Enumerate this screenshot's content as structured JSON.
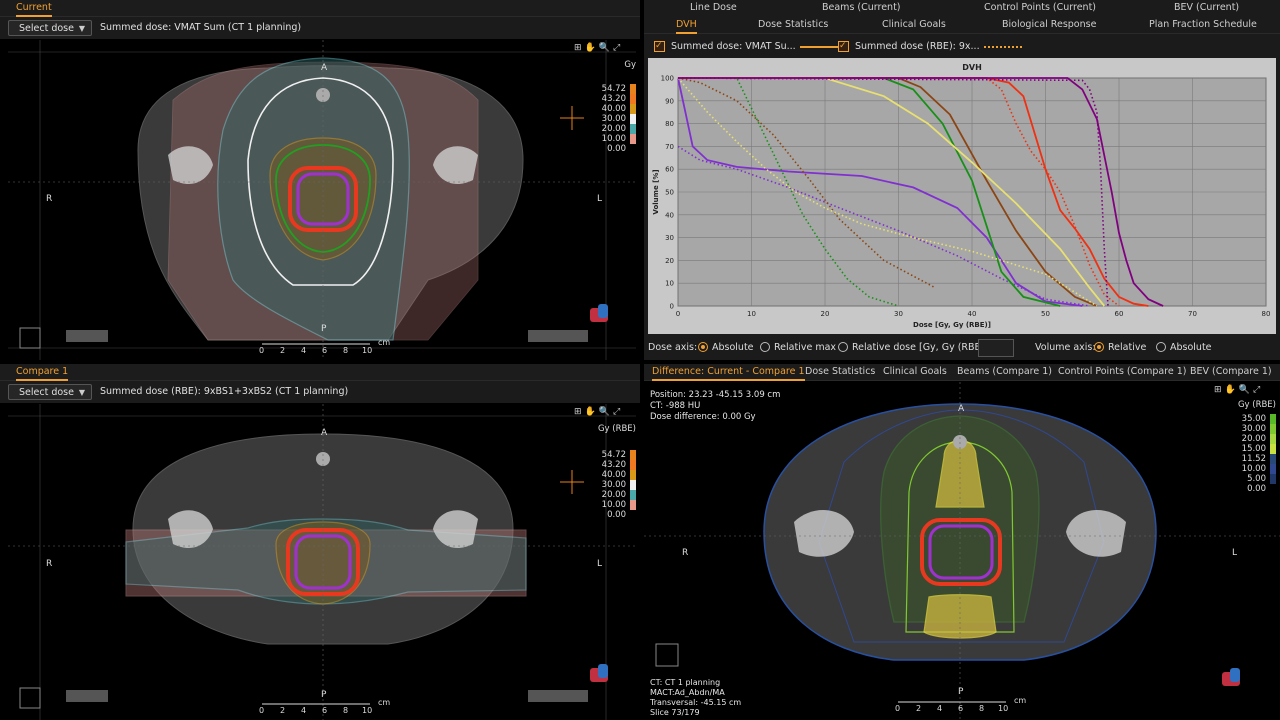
{
  "colors": {
    "accent": "#f0a030",
    "bg": "#000000",
    "tabbar": "#1c1c1c",
    "chart_bg": "#a7a7a7"
  },
  "top_left": {
    "tab": "Current",
    "select_dose": "Select dose",
    "summed": "Summed dose: VMAT Sum (CT 1 planning)",
    "orient": {
      "a": "A",
      "p": "P",
      "r": "R",
      "l": "L"
    },
    "legend_unit": "Gy",
    "legend": [
      {
        "label": "54.72",
        "color": "#e8821c"
      },
      {
        "label": "43.20",
        "color": "#f07820"
      },
      {
        "label": "40.00",
        "color": "#d89818"
      },
      {
        "label": "30.00",
        "color": "#f0f0f0"
      },
      {
        "label": "20.00",
        "color": "#4aa8a8"
      },
      {
        "label": "10.00",
        "color": "#e89888"
      },
      {
        "label": "0.00",
        "color": ""
      }
    ],
    "scale_ticks": [
      "0",
      "2",
      "4",
      "6",
      "8",
      "10"
    ],
    "scale_unit": "cm"
  },
  "bottom_left": {
    "tab": "Compare 1",
    "select_dose": "Select dose",
    "summed": "Summed dose (RBE): 9xBS1+3xBS2 (CT 1 planning)",
    "orient": {
      "a": "A",
      "p": "P",
      "r": "R",
      "l": "L"
    },
    "legend_unit": "Gy (RBE)",
    "legend": [
      {
        "label": "54.72",
        "color": "#e8821c"
      },
      {
        "label": "43.20",
        "color": "#f07820"
      },
      {
        "label": "40.00",
        "color": "#d89818"
      },
      {
        "label": "30.00",
        "color": "#f0f0f0"
      },
      {
        "label": "20.00",
        "color": "#4aa8a8"
      },
      {
        "label": "10.00",
        "color": "#e89888"
      },
      {
        "label": "0.00",
        "color": ""
      }
    ],
    "scale_ticks": [
      "0",
      "2",
      "4",
      "6",
      "8",
      "10"
    ],
    "scale_unit": "cm"
  },
  "top_right": {
    "tabs_row1": [
      "Line Dose",
      "Beams (Current)",
      "Control Points (Current)",
      "BEV (Current)"
    ],
    "tabs_row2": [
      "DVH",
      "Dose Statistics",
      "Clinical Goals",
      "Biological Response",
      "Plan Fraction Schedule"
    ],
    "active_tab": "DVH",
    "series_toggles": [
      {
        "label": "Summed dose: VMAT Su...",
        "style": "solid"
      },
      {
        "label": "Summed dose (RBE): 9x...",
        "style": "dotted"
      }
    ],
    "dose_axis_label": "Dose axis:",
    "dose_axis_options": [
      {
        "label": "Absolute",
        "selected": true
      },
      {
        "label": "Relative max",
        "selected": false
      },
      {
        "label": "Relative dose [Gy, Gy (RBE)]:",
        "selected": false
      }
    ],
    "volume_axis_label": "Volume axis:",
    "volume_axis_options": [
      {
        "label": "Relative",
        "selected": true
      },
      {
        "label": "Absolute",
        "selected": false
      }
    ]
  },
  "bottom_right": {
    "tabs": [
      "Difference: Current - Compare 1",
      "Dose Statistics",
      "Clinical Goals",
      "Beams (Compare 1)",
      "Control Points (Compare 1)",
      "BEV (Compare 1)"
    ],
    "active_tab": "Difference: Current - Compare 1",
    "position": "Position: 23.23 -45.15 3.09 cm",
    "ct": "CT: -988 HU",
    "dose_difference": "Dose difference: 0.00 Gy",
    "orient": {
      "a": "A",
      "p": "P",
      "r": "R",
      "l": "L"
    },
    "legend_unit": "Gy (RBE)",
    "legend": [
      {
        "label": "35.00",
        "color": "#58b828"
      },
      {
        "label": "30.00",
        "color": "#80c830"
      },
      {
        "label": "20.00",
        "color": "#a8d840"
      },
      {
        "label": "15.00",
        "color": "#c8e040"
      },
      {
        "label": "11.52",
        "color": "#284878"
      },
      {
        "label": "10.00",
        "color": "#304890"
      },
      {
        "label": "5.00",
        "color": "#203868"
      },
      {
        "label": "0.00",
        "color": ""
      }
    ],
    "footer": [
      "CT: CT 1 planning",
      "MACT:Ad_Abdn/MA",
      "Transversal: -45.15 cm",
      "Slice 73/179"
    ],
    "scale_ticks": [
      "0",
      "2",
      "4",
      "6",
      "8",
      "10"
    ],
    "scale_unit": "cm"
  },
  "chart_data": {
    "type": "line",
    "title": "DVH",
    "xlabel": "Dose [Gy, Gy (RBE)]",
    "ylabel": "Volume [%]",
    "xlim": [
      0,
      80
    ],
    "ylim": [
      0,
      100
    ],
    "xticks": [
      0,
      10,
      20,
      30,
      40,
      50,
      60,
      70,
      80
    ],
    "yticks": [
      0,
      10,
      20,
      30,
      40,
      50,
      60,
      70,
      80,
      90,
      100
    ],
    "grid": true,
    "series": [
      {
        "color": "#8030d0",
        "style": "solid",
        "x": [
          0,
          1,
          2,
          4,
          8,
          15,
          25,
          32,
          38,
          42,
          46,
          50,
          55
        ],
        "y": [
          100,
          85,
          70,
          64,
          61,
          59,
          57,
          52,
          43,
          30,
          10,
          2,
          0
        ]
      },
      {
        "color": "#8030d0",
        "style": "dotted",
        "x": [
          0,
          3,
          8,
          15,
          22,
          30,
          38,
          44,
          50,
          56
        ],
        "y": [
          70,
          64,
          60,
          52,
          43,
          33,
          22,
          12,
          3,
          0
        ]
      },
      {
        "color": "#189018",
        "style": "solid",
        "x": [
          0,
          28,
          32,
          36,
          40,
          42,
          44,
          47,
          52
        ],
        "y": [
          100,
          100,
          95,
          80,
          55,
          35,
          15,
          4,
          0
        ]
      },
      {
        "color": "#189018",
        "style": "dotted",
        "x": [
          0,
          8,
          11,
          14,
          17,
          20,
          23,
          26,
          30
        ],
        "y": [
          100,
          100,
          80,
          60,
          40,
          25,
          12,
          4,
          0
        ]
      },
      {
        "color": "#8b4513",
        "style": "solid",
        "x": [
          0,
          30,
          33,
          37,
          42,
          46,
          50,
          54,
          57
        ],
        "y": [
          100,
          100,
          96,
          84,
          55,
          33,
          15,
          4,
          0
        ]
      },
      {
        "color": "#8b4513",
        "style": "dotted",
        "x": [
          0,
          3,
          8,
          13,
          18,
          22,
          28,
          35
        ],
        "y": [
          100,
          98,
          90,
          75,
          55,
          38,
          20,
          8
        ]
      },
      {
        "color": "#e8e070",
        "style": "solid",
        "x": [
          0,
          20,
          28,
          34,
          40,
          46,
          52,
          56,
          58
        ],
        "y": [
          100,
          100,
          92,
          80,
          63,
          45,
          25,
          8,
          0
        ]
      },
      {
        "color": "#e8e070",
        "style": "dotted",
        "x": [
          0,
          4,
          8,
          12,
          16,
          20,
          25,
          32,
          40,
          50,
          57
        ],
        "y": [
          100,
          85,
          72,
          60,
          50,
          43,
          36,
          30,
          24,
          14,
          0
        ]
      },
      {
        "color": "#f03010",
        "style": "solid",
        "x": [
          0,
          42,
          45,
          47,
          50,
          52,
          54,
          56,
          58,
          60,
          62,
          64
        ],
        "y": [
          100,
          100,
          98,
          92,
          60,
          42,
          34,
          25,
          12,
          4,
          1,
          0
        ]
      },
      {
        "color": "#f03010",
        "style": "dotted",
        "x": [
          0,
          42,
          44,
          46,
          48,
          50,
          52,
          54,
          56,
          58,
          60
        ],
        "y": [
          100,
          100,
          95,
          80,
          68,
          60,
          50,
          35,
          18,
          5,
          0
        ]
      },
      {
        "color": "#800080",
        "style": "solid",
        "x": [
          0,
          53,
          55,
          57,
          58,
          59,
          60,
          61,
          62,
          64,
          66
        ],
        "y": [
          100,
          100,
          95,
          82,
          66,
          50,
          32,
          20,
          10,
          3,
          0
        ]
      },
      {
        "color": "#800080",
        "style": "dotted",
        "x": [
          0,
          55,
          56,
          57,
          57.5,
          58,
          58.5
        ],
        "y": [
          100,
          99,
          95,
          85,
          60,
          25,
          0
        ]
      }
    ]
  }
}
